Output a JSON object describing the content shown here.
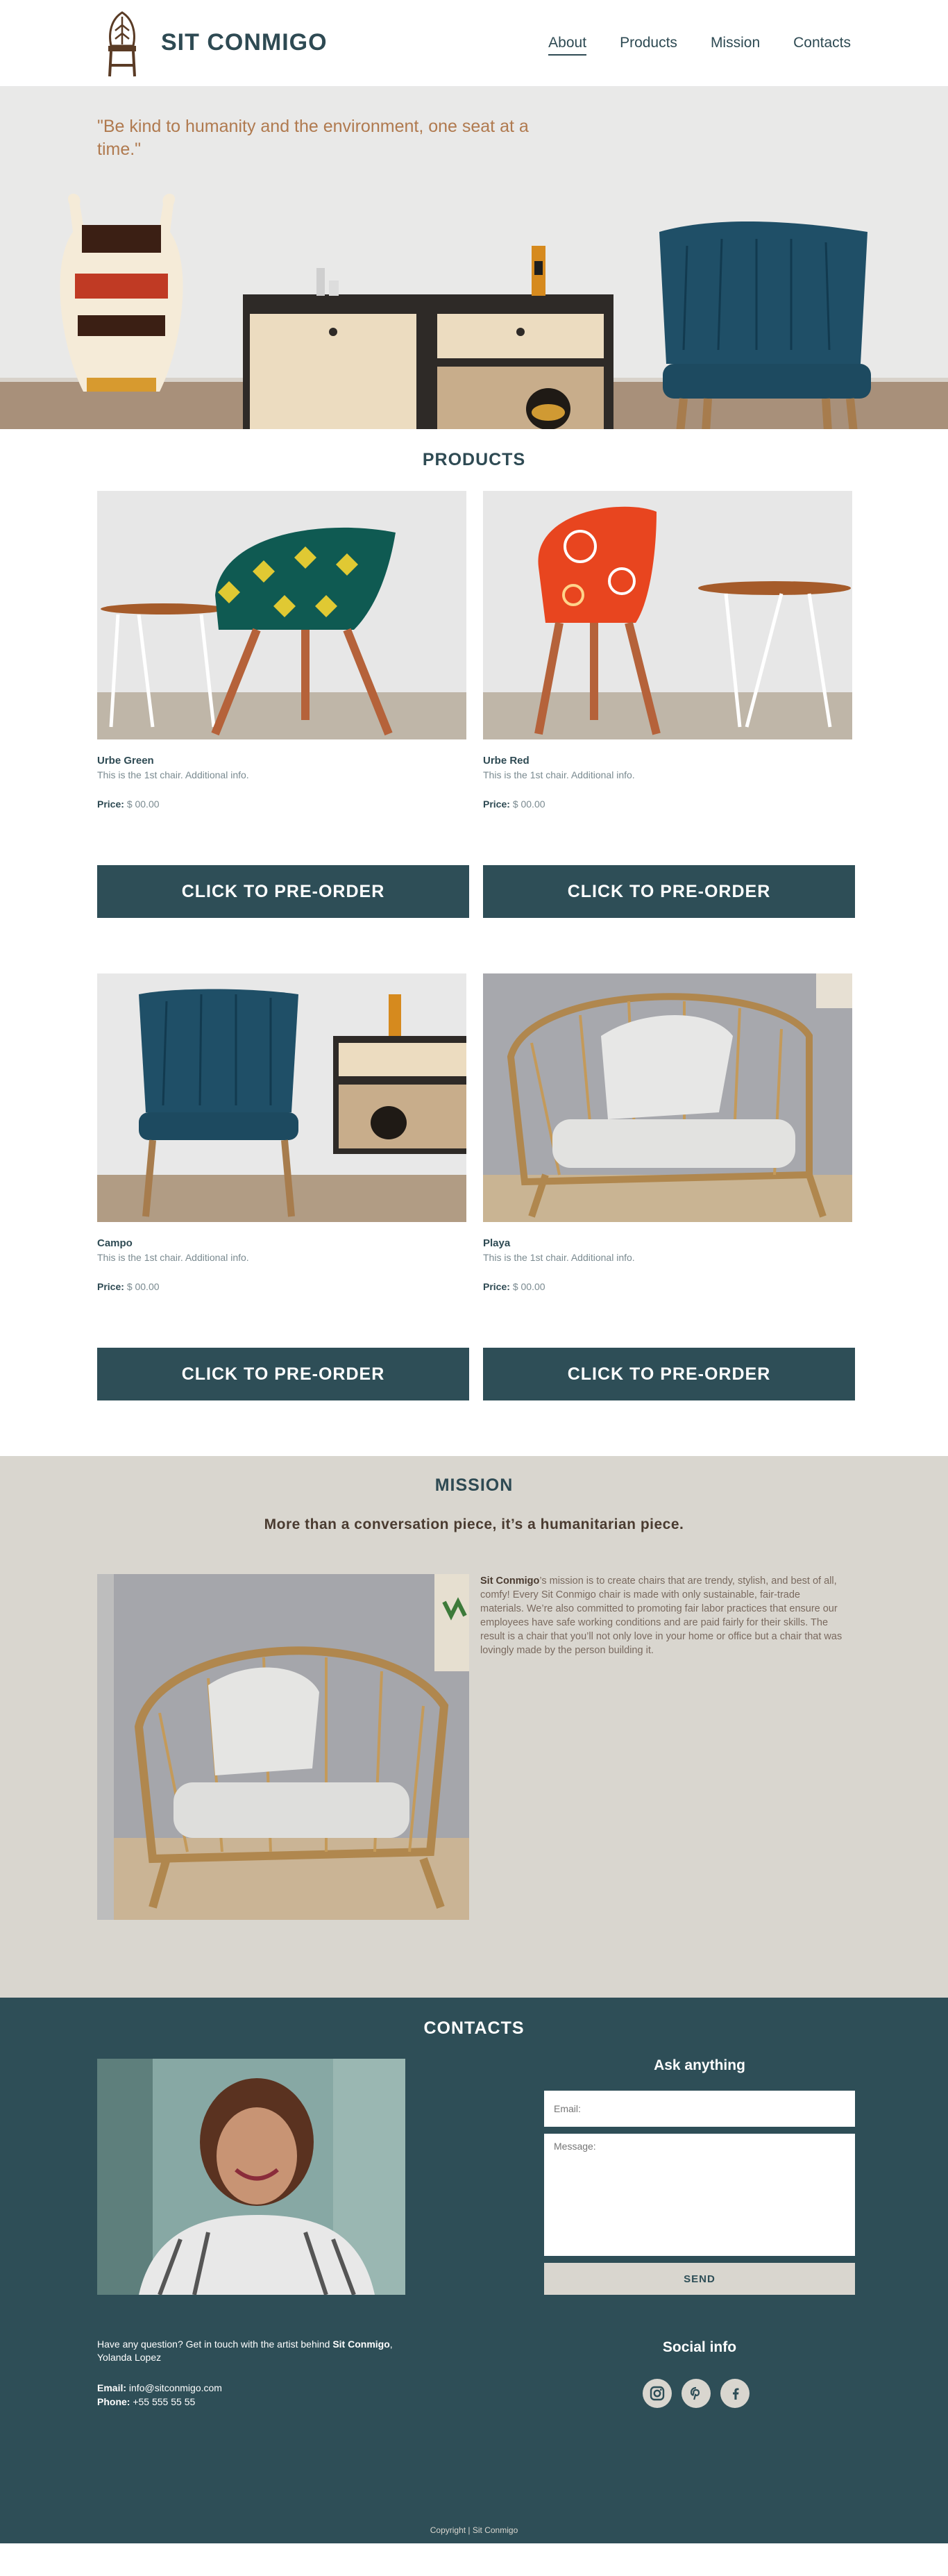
{
  "brand": {
    "name": "SIT CONMIGO"
  },
  "nav": [
    "About",
    "Products",
    "Mission",
    "Contacts"
  ],
  "hero": {
    "quote": "\"Be kind to humanity and the environment, one seat at a time.\""
  },
  "products": {
    "title": "PRODUCTS",
    "price_label": "Price:",
    "items": [
      {
        "name": "Urbe Green",
        "info": "This is the 1st chair. Additional info.",
        "price": "$ 00.00",
        "button": "CLICK TO PRE-ORDER"
      },
      {
        "name": "Urbe Red",
        "info": "This is the 1st chair. Additional info.",
        "price": "$ 00.00",
        "button": "CLICK TO PRE-ORDER"
      },
      {
        "name": "Campo",
        "info": "This is the 1st chair. Additional info.",
        "price": "$ 00.00",
        "button": "CLICK TO PRE-ORDER"
      },
      {
        "name": "Playa",
        "info": "This is the 1st chair. Additional info.",
        "price": "$ 00.00",
        "button": "CLICK TO PRE-ORDER"
      }
    ]
  },
  "mission": {
    "title": "MISSION",
    "subtitle": "More than a conversation piece, it’s a humanitarian piece.",
    "brand": "Sit Conmigo",
    "text_1": "’s mission is to create chairs that are trendy, stylish, and best of all, comfy! Every Sit Conmigo chair is made with only sustainable, fair-trade",
    "text_2": "materials. We’re also committed to promoting fair labor practices that ensure our employees have safe working conditions and are paid fairly for their skills. The result is a chair that you’ll not only love in your home or office but a chair that was lovingly made by the person building it."
  },
  "contacts": {
    "title": "CONTACTS",
    "ask_title": "Ask anything",
    "email_placeholder": "Email:",
    "message_placeholder": "Message:",
    "send": "SEND",
    "blurb_1": "Have any question? Get in touch with the artist behind ",
    "blurb_brand": "Sit Conmigo",
    "blurb_2": ", Yolanda Lopez",
    "email_label": "Email:",
    "email": "info@sitconmigo.com",
    "phone_label": "Phone:",
    "phone": "+55 555 55 55",
    "social_title": "Social info",
    "social": [
      "instagram",
      "pinterest",
      "facebook"
    ],
    "copyright": "Copyright | Sit Conmigo"
  },
  "colors": {
    "primary": "#2e4e57",
    "beige": "#d9d6cf",
    "accent": "#b07a4f"
  }
}
